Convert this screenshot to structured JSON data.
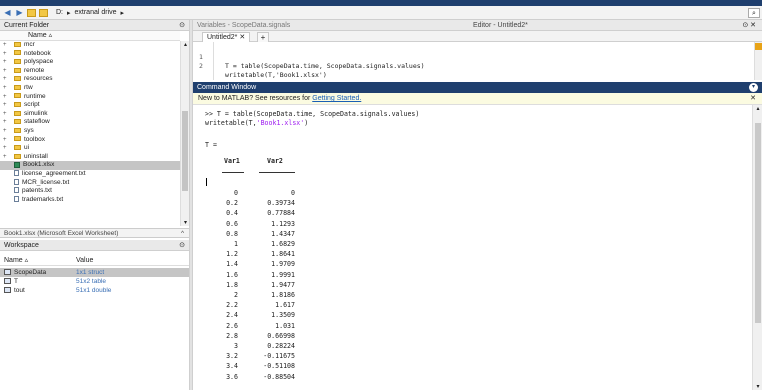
{
  "address": {
    "path": [
      "D:",
      "▸",
      "extranal drive",
      "▸"
    ],
    "search_icon": "search-icon"
  },
  "current_folder": {
    "title": "Current Folder",
    "column": "Name ▵",
    "items": [
      {
        "label": "mcr",
        "kind": "folder",
        "expand": "+"
      },
      {
        "label": "notebook",
        "kind": "folder",
        "expand": "+"
      },
      {
        "label": "polyspace",
        "kind": "folder",
        "expand": "+"
      },
      {
        "label": "remote",
        "kind": "folder",
        "expand": "+"
      },
      {
        "label": "resources",
        "kind": "folder",
        "expand": "+"
      },
      {
        "label": "rtw",
        "kind": "folder",
        "expand": "+"
      },
      {
        "label": "runtime",
        "kind": "folder",
        "expand": "+"
      },
      {
        "label": "script",
        "kind": "folder",
        "expand": "+"
      },
      {
        "label": "simulink",
        "kind": "folder",
        "expand": "+"
      },
      {
        "label": "stateflow",
        "kind": "folder",
        "expand": "+"
      },
      {
        "label": "sys",
        "kind": "folder",
        "expand": "+"
      },
      {
        "label": "toolbox",
        "kind": "folder",
        "expand": "+"
      },
      {
        "label": "ui",
        "kind": "folder",
        "expand": "+"
      },
      {
        "label": "uninstall",
        "kind": "folder",
        "expand": "+"
      },
      {
        "label": "Book1.xlsx",
        "kind": "excel",
        "expand": "",
        "selected": true
      },
      {
        "label": "license_agreement.txt",
        "kind": "doc",
        "expand": ""
      },
      {
        "label": "MCR_license.txt",
        "kind": "doc",
        "expand": ""
      },
      {
        "label": "patents.txt",
        "kind": "doc",
        "expand": ""
      },
      {
        "label": "trademarks.txt",
        "kind": "doc",
        "expand": ""
      }
    ],
    "details": "Book1.xlsx (Microsoft Excel Worksheet)"
  },
  "workspace": {
    "title": "Workspace",
    "col_name": "Name ▵",
    "col_value": "Value",
    "vars": [
      {
        "name": "ScopeData",
        "value": "1x1 struct",
        "selected": true
      },
      {
        "name": "T",
        "value": "51x2 table"
      },
      {
        "name": "tout",
        "value": "51x1 double"
      }
    ]
  },
  "editor": {
    "title_left": "Variables - ScopeData.signals",
    "title_right": "Editor - Untitled2*",
    "tab": "Untitled2*",
    "plus": "+",
    "lines": [
      {
        "n": "1",
        "code": "T = table(ScopeData.time, ScopeData.signals.values)"
      },
      {
        "n": "2",
        "code": "writetable(T,'Book1.xlsx')"
      }
    ]
  },
  "command_window": {
    "title": "Command Window",
    "banner_text": "New to MATLAB? See resources for ",
    "banner_link": "Getting Started.",
    "prompt_line": ">> T = table(ScopeData.time, ScopeData.signals.values)",
    "line2_pre": "writetable(T,",
    "line2_str": "'Book1.xlsx'",
    "line2_post": ")",
    "result_label": "T =",
    "col1": "Var1",
    "col2": "Var2",
    "rows": [
      [
        "0",
        "0"
      ],
      [
        "0.2",
        "0.39734"
      ],
      [
        "0.4",
        "0.77884"
      ],
      [
        "0.6",
        "1.1293"
      ],
      [
        "0.8",
        "1.4347"
      ],
      [
        "1",
        "1.6829"
      ],
      [
        "1.2",
        "1.8641"
      ],
      [
        "1.4",
        "1.9709"
      ],
      [
        "1.6",
        "1.9991"
      ],
      [
        "1.8",
        "1.9477"
      ],
      [
        "2",
        "1.8186"
      ],
      [
        "2.2",
        "1.617"
      ],
      [
        "2.4",
        "1.3509"
      ],
      [
        "2.6",
        "1.031"
      ],
      [
        "2.8",
        "0.66998"
      ],
      [
        "3",
        "0.28224"
      ],
      [
        "3.2",
        "-0.11675"
      ],
      [
        "3.4",
        "-0.51108"
      ],
      [
        "3.6",
        "-0.88504"
      ]
    ]
  }
}
